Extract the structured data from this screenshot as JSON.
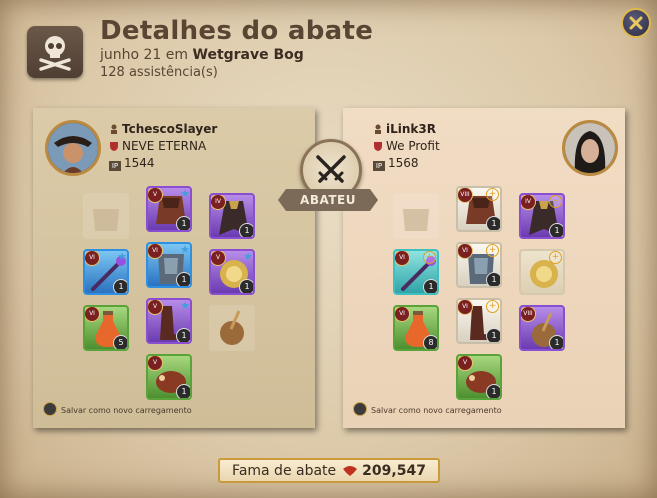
{
  "header": {
    "title": "Detalhes do abate",
    "date": "junho 21 em",
    "location": "Wetgrave Bog",
    "assists_count": "128",
    "assists_label": "assistência(s)",
    "icon": "skull-crossbones-icon"
  },
  "close_icon": "close-icon",
  "killer": {
    "name": "TchescoSlayer",
    "guild": "NEVE ETERNA",
    "ip": "1544",
    "ip_label": "IP",
    "saved_label": "Salvar como novo carregamento",
    "slots": [
      {
        "slot": "bag",
        "empty": true
      },
      {
        "slot": "head",
        "tier": "V",
        "quantity": "1",
        "rarity": "purple",
        "star": true
      },
      {
        "slot": "cape",
        "tier": "IV",
        "quantity": "1",
        "rarity": "purple"
      },
      {
        "slot": "main_hand",
        "tier": "VI",
        "quantity": "1",
        "rarity": "blue",
        "star": true
      },
      {
        "slot": "armor",
        "tier": "VI",
        "quantity": "1",
        "rarity": "blue",
        "star": true
      },
      {
        "slot": "off_hand",
        "tier": "V",
        "quantity": "1",
        "rarity": "purple",
        "star": true
      },
      {
        "slot": "potion",
        "tier": "VI",
        "quantity": "5",
        "rarity": "green"
      },
      {
        "slot": "shoes",
        "tier": "V",
        "quantity": "1",
        "rarity": "purple",
        "star": true
      },
      {
        "slot": "food",
        "empty": true
      },
      {
        "slot": "mount",
        "tier": "V",
        "quantity": "1",
        "rarity": "green"
      }
    ]
  },
  "victim": {
    "name": "iLink3R",
    "guild": "We Profit",
    "ip": "1568",
    "ip_label": "IP",
    "saved_label": "Salvar como novo carregamento",
    "slots": [
      {
        "slot": "bag",
        "empty": true
      },
      {
        "slot": "head",
        "tier": "VIII",
        "quantity": "1",
        "rarity": "white",
        "plus": true
      },
      {
        "slot": "cape",
        "tier": "IV",
        "quantity": "1",
        "rarity": "purple",
        "plus": true
      },
      {
        "slot": "main_hand",
        "tier": "VI",
        "quantity": "1",
        "rarity": "teal",
        "plus": true
      },
      {
        "slot": "armor",
        "tier": "VI",
        "quantity": "1",
        "rarity": "white",
        "plus": true
      },
      {
        "slot": "off_hand",
        "tier": "",
        "quantity": "",
        "rarity": "faded",
        "plus": true
      },
      {
        "slot": "potion",
        "tier": "VI",
        "quantity": "8",
        "rarity": "green"
      },
      {
        "slot": "shoes",
        "tier": "VI",
        "quantity": "1",
        "rarity": "white",
        "plus": true
      },
      {
        "slot": "food",
        "tier": "VIII",
        "quantity": "1",
        "rarity": "purple"
      },
      {
        "slot": "mount",
        "tier": "V",
        "quantity": "1",
        "rarity": "green"
      }
    ]
  },
  "center": {
    "icon": "crossed-swords-icon",
    "label": "ABATEU"
  },
  "fame": {
    "label": "Fama de abate",
    "value": "209,547",
    "icon": "blood-drop-icon"
  },
  "colors": {
    "purple": "#8a4fd0",
    "blue": "#2f8fe0",
    "green": "#59a33a",
    "teal": "#3fbfc0",
    "white": "#e9e4d8",
    "gold": "#e0a020"
  }
}
